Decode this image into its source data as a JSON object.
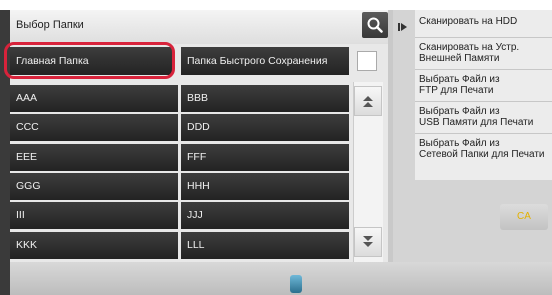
{
  "header": {
    "title": "Выбор Папки",
    "search_icon": "search-icon"
  },
  "top_buttons": {
    "main_folder": "Главная Папка",
    "quick_save_folder": "Папка Быстрого Сохранения"
  },
  "folders": [
    [
      "AAA",
      "BBB"
    ],
    [
      "CCC",
      "DDD"
    ],
    [
      "EEE",
      "FFF"
    ],
    [
      "GGG",
      "HHH"
    ],
    [
      "III",
      "JJJ"
    ],
    [
      "KKK",
      "LLL"
    ]
  ],
  "sidebar": {
    "items": [
      "Сканировать на HDD",
      "Сканировать на Устр.\nВнешней Памяти",
      "Выбрать Файл из\nFTP для Печати",
      "Выбрать Файл из\nUSB Памяти для Печати",
      "Выбрать Файл из\nСетевой Папки для Печати"
    ]
  },
  "ca_button": "CA",
  "colors": {
    "highlight": "#d8233b",
    "ca_text": "#e3b100",
    "folder_button": "#2d2d2d"
  }
}
